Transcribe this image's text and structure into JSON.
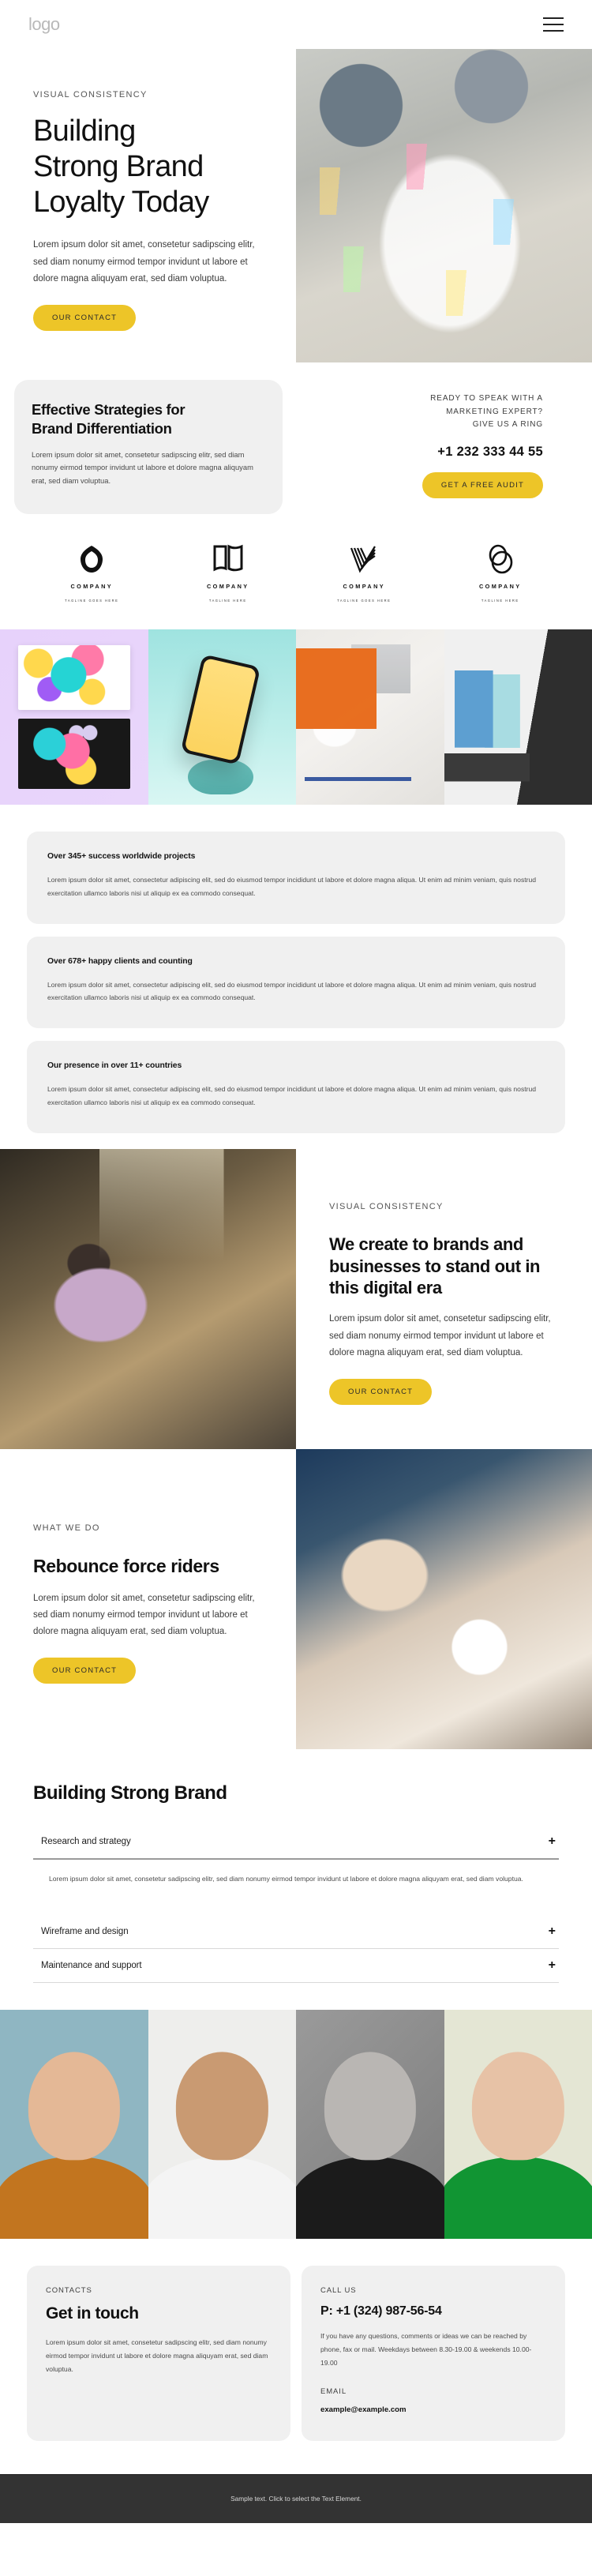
{
  "header": {
    "logo": "logo",
    "menu_icon": "hamburger-menu-icon"
  },
  "hero": {
    "eyebrow": "VISUAL CONSISTENCY",
    "title_line1": "Building",
    "title_line2": "Strong Brand",
    "title_line3": "Loyalty Today",
    "body": "Lorem ipsum dolor sit amet, consetetur sadipscing elitr, sed diam nonumy eirmod tempor invidunt ut labore et dolore magna aliquyam erat, sed diam voluptua.",
    "cta": "OUR CONTACT"
  },
  "strategies": {
    "title_line1": "Effective Strategies for",
    "title_line2": "Brand Differentiation",
    "body": "Lorem ipsum dolor sit amet, consetetur sadipscing elitr, sed diam nonumy eirmod tempor invidunt ut labore et dolore magna aliquyam erat, sed diam voluptua.",
    "ready_line1": "READY TO SPEAK WITH A",
    "ready_line2": "MARKETING EXPERT?",
    "ready_line3": "GIVE US A RING",
    "phone": "+1 232 333 44 55",
    "cta": "GET A FREE AUDIT"
  },
  "logos": [
    {
      "name": "COMPANY",
      "tagline": "TAGLINE GOES HERE",
      "mark": "infinity-loop-logo-icon"
    },
    {
      "name": "COMPANY",
      "tagline": "TAGLINE HERE",
      "mark": "open-book-logo-icon"
    },
    {
      "name": "COMPANY",
      "tagline": "TAGLINE GOES HERE",
      "mark": "striped-v-logo-icon"
    },
    {
      "name": "COMPANY",
      "tagline": "TAGLINE HERE",
      "mark": "double-oval-logo-icon"
    }
  ],
  "gallery": [
    {
      "name": "brand-card-mockup"
    },
    {
      "name": "phone-mockup"
    },
    {
      "name": "desk-stationery-flatlay"
    },
    {
      "name": "paper-stationery-mockup"
    }
  ],
  "stats": [
    {
      "title": "Over 345+ success worldwide projects",
      "body": "Lorem ipsum dolor sit amet, consectetur adipiscing elit, sed do eiusmod tempor incididunt ut labore et dolore magna aliqua. Ut enim ad minim veniam, quis nostrud exercitation ullamco laboris nisi ut aliquip ex ea commodo consequat."
    },
    {
      "title": "Over 678+ happy clients and counting",
      "body": "Lorem ipsum dolor sit amet, consectetur adipiscing elit, sed do eiusmod tempor incididunt ut labore et dolore magna aliqua. Ut enim ad minim veniam, quis nostrud exercitation ullamco laboris nisi ut aliquip ex ea commodo consequat."
    },
    {
      "title": "Our presence in over 11+ countries",
      "body": "Lorem ipsum dolor sit amet, consectetur adipiscing elit, sed do eiusmod tempor incididunt ut labore et dolore magna aliqua. Ut enim ad minim veniam, quis nostrud exercitation ullamco laboris nisi ut aliquip ex ea commodo consequat."
    }
  ],
  "create_section": {
    "eyebrow": "VISUAL CONSISTENCY",
    "heading": "We create to brands and businesses to stand out in this digital era",
    "body": "Lorem ipsum dolor sit amet, consetetur sadipscing elitr, sed diam nonumy eirmod tempor invidunt ut labore et dolore magna aliquyam erat, sed diam voluptua.",
    "cta": "OUR CONTACT",
    "media": "office-woman-at-desk-photo"
  },
  "rebounce_section": {
    "eyebrow": "WHAT WE DO",
    "heading": "Rebounce force riders",
    "body": "Lorem ipsum dolor sit amet, consetetur sadipscing elitr, sed diam nonumy eirmod tempor invidunt ut labore et dolore magna aliquyam erat, sed diam voluptua.",
    "cta": "OUR CONTACT",
    "media": "hands-meeting-coffee-photo"
  },
  "accordion": {
    "title": "Building Strong Brand",
    "items": [
      {
        "label": "Research and strategy",
        "open": true,
        "body": "Lorem ipsum dolor sit amet, consetetur sadipscing elitr, sed diam nonumy eirmod tempor invidunt ut labore et dolore magna aliquyam erat, sed diam voluptua.",
        "icon": "plus-icon"
      },
      {
        "label": "Wireframe and design",
        "open": false,
        "body": "",
        "icon": "plus-icon"
      },
      {
        "label": "Maintenance and support",
        "open": false,
        "body": "",
        "icon": "plus-icon"
      }
    ]
  },
  "portraits": [
    {
      "name": "portrait-man-orange-shirt"
    },
    {
      "name": "portrait-woman-glasses"
    },
    {
      "name": "portrait-bearded-man-bw"
    },
    {
      "name": "portrait-blonde-woman-green"
    }
  ],
  "contact": {
    "left": {
      "eyebrow": "CONTACTS",
      "heading": "Get in touch",
      "body": "Lorem ipsum dolor sit amet, consetetur sadipscing elitr, sed diam nonumy eirmod tempor invidunt ut labore et dolore magna aliquyam erat, sed diam voluptua."
    },
    "right": {
      "eyebrow": "CALL US",
      "phone": "P: +1 (324) 987-56-54",
      "body": "If you have any questions, comments or ideas we can be reached by phone, fax or mail. Weekdays between 8.30-19.00 & weekends 10.00-19.00",
      "email_label": "EMAIL",
      "email": "example@example.com"
    }
  },
  "footer": {
    "text": "Sample text. Click to select the Text Element."
  },
  "colors": {
    "accent": "#edc528",
    "card_bg": "#f0f0f0",
    "footer_bg": "#333333",
    "text": "#1a1a1a"
  }
}
